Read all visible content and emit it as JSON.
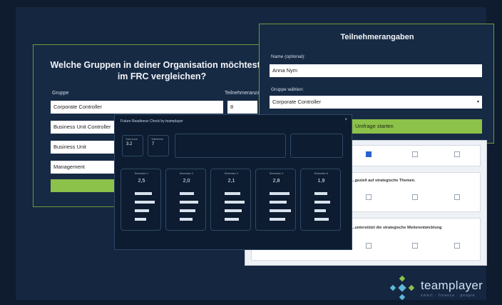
{
  "main_form": {
    "title": "Welche Gruppen in deiner Organisation möchtest du im FRC vergleichen?",
    "group_label": "Gruppe",
    "count_label": "Teilnehmeranzahl",
    "rows": [
      {
        "group": "Corporate Controller",
        "count": "8"
      },
      {
        "group": "Business Unit Controller",
        "count": ""
      },
      {
        "group": "Business Unit",
        "count": ""
      },
      {
        "group": "Management",
        "count": ""
      }
    ]
  },
  "participant": {
    "title": "Teilnehmerangaben",
    "name_label": "Name (optional):",
    "name_value": "Anna Nym",
    "group_label": "Gruppe wählen:",
    "group_value": "Corporate Controller",
    "start_button": "Umfrage starten"
  },
  "survey": {
    "questions": [
      "",
      "...gezielt auf strategische Themen.",
      "...unterstützt die strategische Weiterentwicklung"
    ]
  },
  "dashboard": {
    "title": "Future Readiness Check by teamplayer",
    "close": "×",
    "stats": [
      {
        "label": "Total score",
        "value": "3.2"
      },
      {
        "label": "Teilnehmer",
        "value": "7"
      }
    ],
    "columns": [
      {
        "title": "Dimension 1",
        "score": "2,5"
      },
      {
        "title": "Dimension 2",
        "score": "2,0"
      },
      {
        "title": "Dimension 3",
        "score": "2,1"
      },
      {
        "title": "Dimension 4",
        "score": "2,8"
      },
      {
        "title": "Dimension 5",
        "score": "1,9"
      }
    ],
    "footer": ""
  },
  "logo": {
    "name": "teamplayer",
    "tagline": "smart · finance · people"
  },
  "colors": {
    "accent_green": "#8cc14a",
    "navy": "#172a44",
    "select_blue": "#2b62c9"
  }
}
